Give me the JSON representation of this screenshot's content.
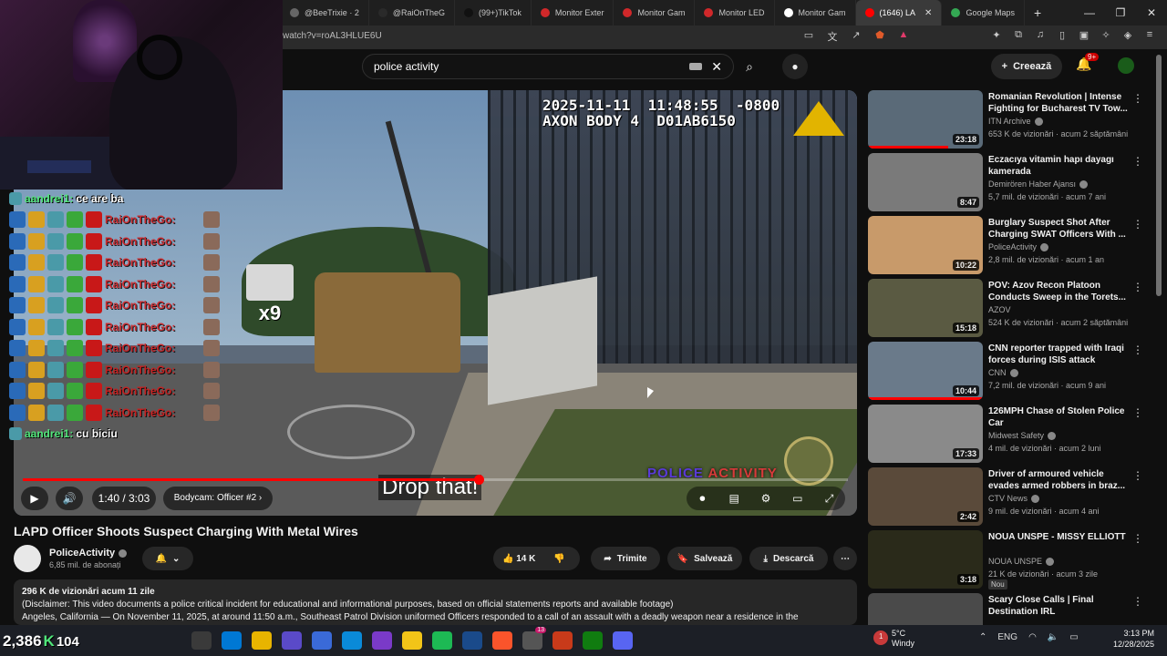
{
  "browser": {
    "tabs": [
      {
        "label": "@BeeTrixie · 2",
        "icon_color": "#666666"
      },
      {
        "label": "@RaiOnTheG",
        "icon_color": "#2a2a2a"
      },
      {
        "label": "(99+)TikTok",
        "icon_color": "#111111"
      },
      {
        "label": "Monitor Exter",
        "icon_color": "#d0282a"
      },
      {
        "label": "Monitor Gam",
        "icon_color": "#d0282a"
      },
      {
        "label": "Monitor LED",
        "icon_color": "#d0282a"
      },
      {
        "label": "Monitor Gam",
        "icon_color": "#ffffff"
      },
      {
        "label": "(1646) LA",
        "icon_color": "#ff0000",
        "active": true
      },
      {
        "label": "Google Maps",
        "icon_color": "#34a853"
      }
    ],
    "new_tab": "+",
    "url": "watch?v=roAL3HLUE6U",
    "window_controls": [
      "—",
      "❐",
      "✕"
    ]
  },
  "youtube": {
    "search_value": "police activity",
    "create_label": "Creează",
    "notif_badge": "9+"
  },
  "video": {
    "stamp_line1": "2025-11-11  11:48:55  -0800",
    "stamp_line2": "AXON BODY 4  D01AB6150",
    "watermark_a": "POLICE",
    "watermark_b": "ACTIVITY",
    "caption": "Drop that!",
    "time": "1:40 / 3:03",
    "chapter": "Bodycam: Officer #2",
    "progress": 0.553
  },
  "chat": {
    "first": {
      "user": "aandrei1:",
      "msg": "ce are ba"
    },
    "spam_name": "RaiOnTheGo:",
    "spam_count": 10,
    "last": {
      "user": "aandrei1:",
      "msg": "cu biciu"
    },
    "gift_multiplier": "x9"
  },
  "info": {
    "title": "LAPD Officer Shoots Suspect Charging With Metal Wires",
    "channel": "PoliceActivity",
    "subs": "6,85 mil. de abonați",
    "likes": "14 K",
    "share": "Trimite",
    "save": "Salvează",
    "download": "Descarcă",
    "views_date": "296 K de vizionări  acum 11 zile",
    "desc_line1": "(Disclaimer: This video documents a police critical incident for educational and informational purposes, based on official statements reports and available footage)",
    "desc_line2": "Angeles, California — On November 11, 2025, at around 11:50 a.m., Southeast Patrol Division uniformed Officers responded to a call of an assault with a deadly weapon near a residence in the"
  },
  "recommendations": [
    {
      "title": "Romanian Revolution | Intense Fighting for Bucharest TV Tow...",
      "channel": "ITN Archive",
      "meta": "653 K de vizionări · acum 2 săptămâni",
      "duration": "23:18",
      "thumb": "#5a6a78",
      "watched": 0.7,
      "verified": true
    },
    {
      "title": "Eczacıya vitamin hapı dayagı kamerada",
      "channel": "Demirören Haber Ajansı",
      "meta": "5,7 mil. de vizionări · acum 7 ani",
      "duration": "8:47",
      "thumb": "#7a7a7a",
      "watched": 0,
      "verified": true
    },
    {
      "title": "Burglary Suspect Shot After Charging SWAT Officers With ...",
      "channel": "PoliceActivity",
      "meta": "2,8 mil. de vizionări · acum 1 an",
      "duration": "10:22",
      "thumb": "#c89a6a",
      "watched": 0,
      "verified": true
    },
    {
      "title": "POV: Azov Recon Platoon Conducts Sweep in the Torets...",
      "channel": "AZOV",
      "meta": "524 K de vizionări · acum 2 săptămâni",
      "duration": "15:18",
      "thumb": "#5a5a42",
      "watched": 0,
      "verified": false
    },
    {
      "title": "CNN reporter trapped with Iraqi forces during ISIS attack",
      "channel": "CNN",
      "meta": "7,2 mil. de vizionări · acum 9 ani",
      "duration": "10:44",
      "thumb": "#6a7a8a",
      "watched": 1.0,
      "verified": true
    },
    {
      "title": "126MPH Chase of Stolen Police Car",
      "channel": "Midwest Safety",
      "meta": "4 mil. de vizionări · acum 2 luni",
      "duration": "17:33",
      "thumb": "#8a8a8a",
      "watched": 0,
      "verified": true
    },
    {
      "title": "Driver of armoured vehicle evades armed robbers in braz...",
      "channel": "CTV News",
      "meta": "9 mil. de vizionări · acum 4 ani",
      "duration": "2:42",
      "thumb": "#5a4a3a",
      "watched": 0,
      "verified": true
    },
    {
      "title": "NOUA UNSPE - MISSY ELLIOTT",
      "channel": "NOUA UNSPE",
      "meta": "21 K de vizionări · acum 3 zile",
      "duration": "3:18",
      "thumb": "#2a2a1a",
      "watched": 0,
      "verified": true,
      "badge": "Nou"
    },
    {
      "title": "Scary Close Calls | Final Destination IRL",
      "channel": "",
      "meta": "",
      "duration": "",
      "thumb": "#4a4a4a",
      "watched": 0,
      "verified": false
    }
  ],
  "taskbar": {
    "viewers_a": "2,386",
    "viewers_b": "104",
    "weather_badge": "1",
    "temp": "5°C",
    "weather": "Windy",
    "lang": "ENG",
    "time": "3:13 PM",
    "date": "12/28/2025",
    "app_colors": [
      "#3a3a3a",
      "#0078d4",
      "#e8b400",
      "#5a4ac8",
      "#3a6ad8",
      "#0a8ad8",
      "#7a3ac8",
      "#f2c418",
      "#1db954",
      "#1a4a8a",
      "#fb542b",
      "#555555",
      "#c83a1a",
      "#107c10",
      "#5865f2"
    ],
    "app_badges": {
      "11": "13"
    }
  }
}
